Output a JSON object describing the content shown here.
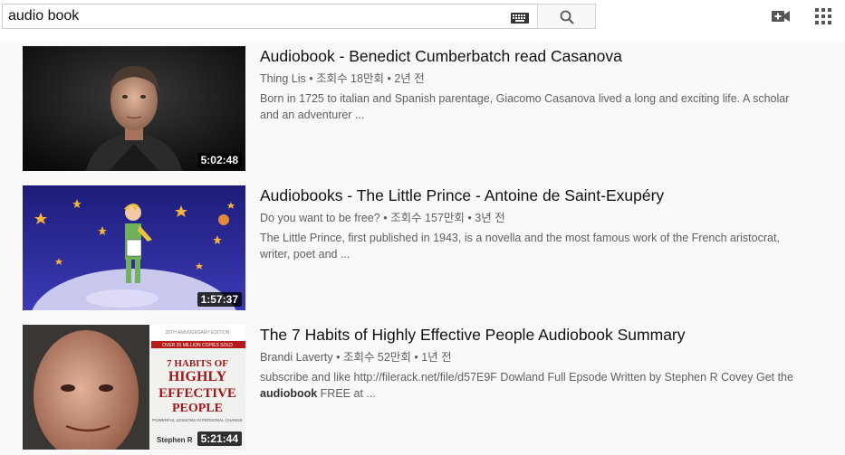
{
  "search": {
    "value": "audio book"
  },
  "header_icons": [
    "keyboard-icon",
    "search-icon",
    "video-camera-add-icon",
    "apps-grid-icon"
  ],
  "results": [
    {
      "title": "Audiobook - Benedict Cumberbatch read Casanova",
      "channel": "Thing Lis",
      "views": "조회수 18만회",
      "age": "2년 전",
      "description": "Born in 1725 to italian and Spanish parentage, Giacomo Casanova lived a long and exciting life. A scholar and an adventurer ...",
      "duration": "5:02:48"
    },
    {
      "title": "Audiobooks - The Little Prince - Antoine de Saint-Exupéry",
      "channel": "Do you want to be free?",
      "views": "조회수 157만회",
      "age": "3년 전",
      "description": "The Little Prince, first published in 1943, is a novella and the most famous work of the French aristocrat, writer, poet and ...",
      "duration": "1:57:37"
    },
    {
      "title": "The 7 Habits of Highly Effective People Audiobook Summary",
      "channel": "Brandi Laverty",
      "views": "조회수 52만회",
      "age": "1년 전",
      "description_before": "subscribe and like http://filerack.net/file/d57E9F Dowland Full Epsode Written by Stephen R Covey Get the ",
      "description_bold": "audiobook",
      "description_after": " FREE at ...",
      "duration": "5:21:44",
      "thumb_text": {
        "edition": "25TH ANNIVERSARY EDITION",
        "sold": "OVER 25 MILLION COPIES SOLD",
        "line1": "7 HABITS OF",
        "line2": "HIGHLY",
        "line3": "EFFECTIVE",
        "line4": "PEOPLE",
        "sub": "POWERFUL LESSONS IN PERSONAL CHANGE",
        "author": "Stephen R"
      }
    }
  ]
}
